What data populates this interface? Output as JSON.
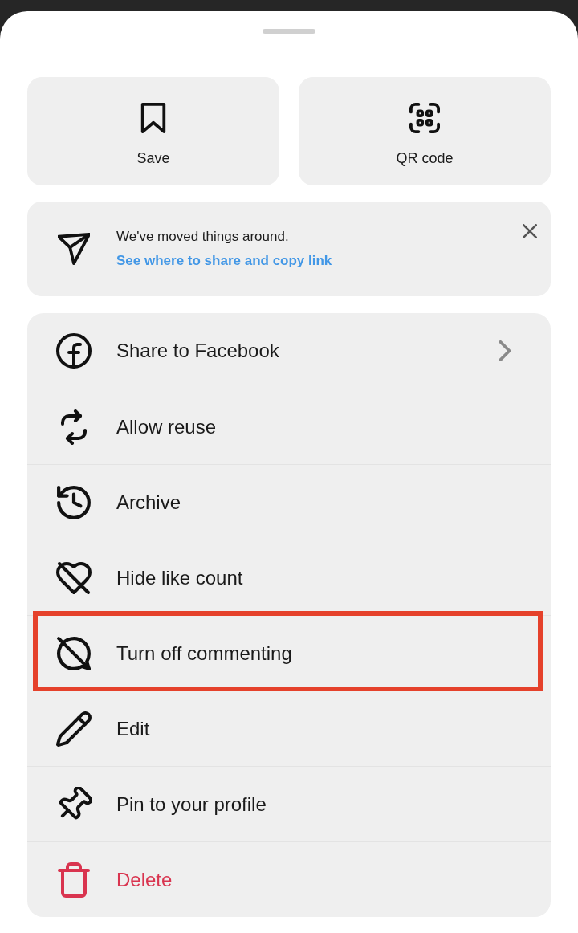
{
  "quick_actions": [
    {
      "label": "Save"
    },
    {
      "label": "QR code"
    }
  ],
  "notice": {
    "message": "We've moved things around.",
    "link": "See where to share and copy link"
  },
  "menu": [
    {
      "label": "Share to Facebook",
      "has_submenu": true,
      "destructive": false,
      "highlighted": false
    },
    {
      "label": "Allow reuse",
      "has_submenu": false,
      "destructive": false,
      "highlighted": false
    },
    {
      "label": "Archive",
      "has_submenu": false,
      "destructive": false,
      "highlighted": false
    },
    {
      "label": "Hide like count",
      "has_submenu": false,
      "destructive": false,
      "highlighted": false
    },
    {
      "label": "Turn off commenting",
      "has_submenu": false,
      "destructive": false,
      "highlighted": true
    },
    {
      "label": "Edit",
      "has_submenu": false,
      "destructive": false,
      "highlighted": false
    },
    {
      "label": "Pin to your profile",
      "has_submenu": false,
      "destructive": false,
      "highlighted": false
    },
    {
      "label": "Delete",
      "has_submenu": false,
      "destructive": true,
      "highlighted": false
    }
  ]
}
